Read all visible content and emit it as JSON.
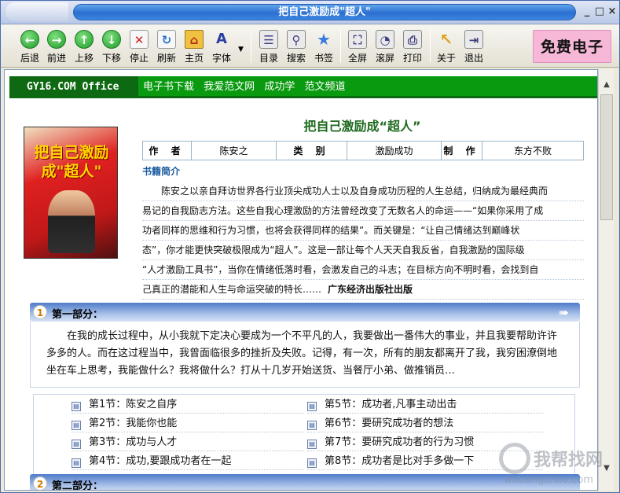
{
  "window": {
    "title": "把自己激励成\"超人\"",
    "controls": [
      "_",
      "□",
      "×"
    ]
  },
  "toolbar": {
    "buttons": [
      {
        "label": "后退",
        "icon": "back-icon",
        "glyph": "←"
      },
      {
        "label": "前进",
        "icon": "forward-icon",
        "glyph": "→"
      },
      {
        "label": "上移",
        "icon": "up-icon",
        "glyph": "↑"
      },
      {
        "label": "下移",
        "icon": "down-icon",
        "glyph": "↓"
      },
      {
        "label": "停止",
        "icon": "stop-icon",
        "glyph": "✕"
      },
      {
        "label": "刷新",
        "icon": "refresh-icon",
        "glyph": "↻"
      },
      {
        "label": "主页",
        "icon": "home-icon",
        "glyph": "⌂"
      },
      {
        "label": "字体",
        "icon": "font-icon",
        "glyph": "A"
      },
      {
        "label": "目录",
        "icon": "contents-icon",
        "glyph": "☰"
      },
      {
        "label": "搜索",
        "icon": "search-icon",
        "glyph": "⚲"
      },
      {
        "label": "书签",
        "icon": "bookmark-icon",
        "glyph": "★"
      },
      {
        "label": "全屏",
        "icon": "fullscreen-icon",
        "glyph": "⛶"
      },
      {
        "label": "滚屏",
        "icon": "autoscroll-icon",
        "glyph": "◔"
      },
      {
        "label": "打印",
        "icon": "print-icon",
        "glyph": "⎙"
      },
      {
        "label": "关于",
        "icon": "about-icon",
        "glyph": "↖"
      },
      {
        "label": "退出",
        "icon": "exit-icon",
        "glyph": "⇥"
      }
    ],
    "brand": "免费电子书"
  },
  "nav": {
    "site": "GY16.COM Office",
    "links": [
      "电子书下载",
      "我爱范文网",
      "成功学",
      "范文频道"
    ]
  },
  "book": {
    "cover_text": "把自己激励成\"超人\"",
    "title": "把自己激励成“超人”",
    "info": [
      {
        "key": "作 者",
        "value": "陈安之"
      },
      {
        "key": "类 别",
        "value": "激励成功"
      },
      {
        "key": "制 作",
        "value": "东方不败"
      }
    ],
    "intro_heading": "书籍简介",
    "intro_lines": [
      "　　陈安之以亲自拜访世界各行业顶尖成功人士以及自身成功历程的人生总结，归纳成为最经典而",
      "易记的自我励志方法。这些自我心理激励的方法曾经改变了无数名人的命运——“如果你采用了成",
      "功者同样的思维和行为习惯，也将会获得同样的结果”。而关键是：“让自己情绪达到巅峰状",
      "态”，你才能更快突破极限成为“超人”。这是一部让每个人天天自我反省，自我激励的国际级",
      "“人才激励工具书”，当你在情绪低落时看，会激发自己的斗志；在目标方向不明时看，会找到自",
      "己真正的潜能和人生与命运突破的特长……"
    ],
    "publisher": "广东经济出版社出版"
  },
  "part1": {
    "num": "1",
    "title": "第一部分：",
    "summary": "在我的成长过程中，从小我就下定决心要成为一个不平凡的人，我要做出一番伟大的事业，并且我要帮助许许多多的人。而在这过程当中，我曾面临很多的挫折及失败。记得，有一次，所有的朋友都离开了我，我穷困潦倒地坐在车上思考，我能做什么？我将做什么？打从十几岁开始送货、当餐厅小弟、做推销员…",
    "chapters_left": [
      "第1节：陈安之自序",
      "第2节：我能你也能",
      "第3节：成功与人才",
      "第4节：成功,要跟成功者在一起"
    ],
    "chapters_right": [
      "第5节：成功者,凡事主动出击",
      "第6节：要研究成功者的想法",
      "第7节：要研究成功者的行为习惯",
      "第8节：成功者是比对手多做一下"
    ]
  },
  "part2": {
    "num": "2",
    "title": "第二部分："
  },
  "watermark": {
    "name": "我帮找网",
    "url": "wobangzhao.com"
  }
}
